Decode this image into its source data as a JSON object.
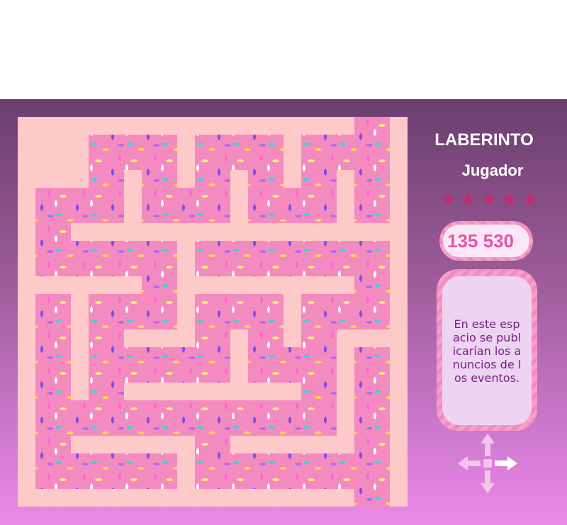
{
  "game": {
    "title": "LABERINTO",
    "player_label": "Jugador",
    "stars": {
      "count": 5,
      "icon": "star-icon",
      "color": "#c6296e"
    },
    "score": "135 530",
    "ad_text": "En este espacio se publicarían los anuncios de los eventos.",
    "controls": {
      "up": "arrow-up-icon",
      "down": "arrow-down-icon",
      "left": "arrow-left-icon",
      "right": "arrow-right-icon",
      "active": "right"
    }
  },
  "colors": {
    "wall": "#fdc9c9",
    "floor": "#f48bc0",
    "background_top": "#6b3e6e",
    "background_bottom": "#ec8aea",
    "accent": "#c6296e",
    "score_text": "#e256a8",
    "ad_text": "#7a1f82"
  }
}
